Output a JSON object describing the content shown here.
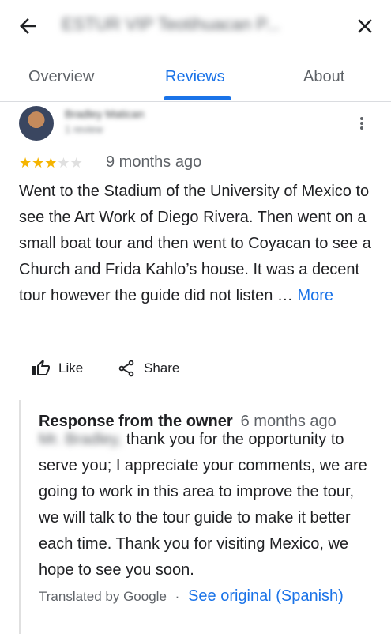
{
  "header": {
    "title": "ESTUR VIP Teotihuacan P...",
    "back_icon": "arrow-left-icon",
    "close_icon": "close-icon"
  },
  "tabs": [
    {
      "label": "Overview",
      "active": false
    },
    {
      "label": "Reviews",
      "active": true
    },
    {
      "label": "About",
      "active": false
    }
  ],
  "review": {
    "reviewer_name": "Bradley Matican",
    "reviewer_meta": "1 review",
    "rating": 3,
    "max_rating": 5,
    "time": "9 months ago",
    "text": "Went to the Stadium of the University of Mexico to see the Art Work of Diego Rivera. Then went on a small boat tour and then went to Coyacan to see a Church and Frida Kahlo’s house. It was a decent tour however the guide did not listen … ",
    "more_label": "More",
    "like_label": "Like",
    "share_label": "Share"
  },
  "owner_response": {
    "label": "Response from the owner",
    "time": "6 months ago",
    "greeting": "Mr. Bradley,",
    "text": "thank you for the opportunity to serve you; I appreciate your comments, we are going to work in this area to improve the tour, we will talk to the tour guide to make it better each time. Thank you for visiting Mexico, we hope to see you soon.",
    "translated_by": "Translated by Google",
    "separator": "·",
    "see_original": "See original (Spanish)"
  },
  "colors": {
    "accent": "#1a73e8",
    "star": "#f5b400",
    "star_empty": "#e0e0e0"
  }
}
